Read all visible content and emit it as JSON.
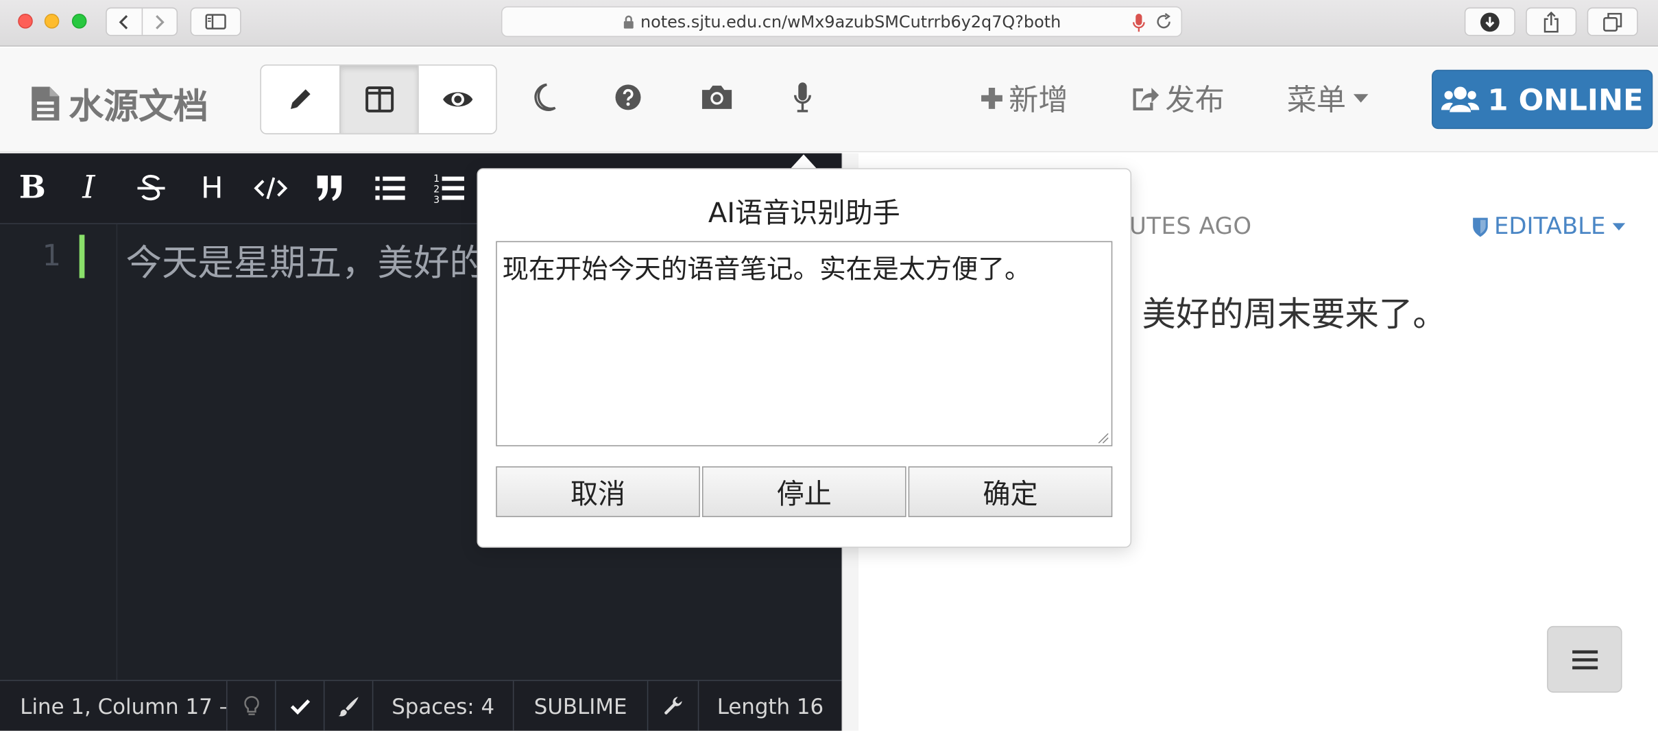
{
  "browser": {
    "url": "notes.sjtu.edu.cn/wMx9azubSMCutrrb6y2q7Q?both"
  },
  "header": {
    "brand": "水源文档",
    "new_label": "新增",
    "publish_label": "发布",
    "menu_label": "菜单",
    "online_label": "1 ONLINE"
  },
  "editor": {
    "toolbar": {
      "bold": "B",
      "italic": "I",
      "heading": "H"
    },
    "line_number": "1",
    "line_text": "今天是星期五，美好的",
    "status": {
      "position": "Line 1, Column 17 —",
      "spaces": "Spaces: 4",
      "keymap": "SUBLIME",
      "length": "Length 16"
    }
  },
  "preview": {
    "meta": "UTES AGO",
    "permission": "EDITABLE",
    "text": "美好的周末要来了。"
  },
  "dialog": {
    "title": "AI语音识别助手",
    "transcript": "现在开始今天的语音笔记。实在是太方便了。",
    "cancel_label": "取消",
    "stop_label": "停止",
    "confirm_label": "确定"
  },
  "colors": {
    "accent": "#337ab7",
    "editor_bg": "#1e2127",
    "cursor": "#8ae06a",
    "mic_red": "#d9534f"
  }
}
